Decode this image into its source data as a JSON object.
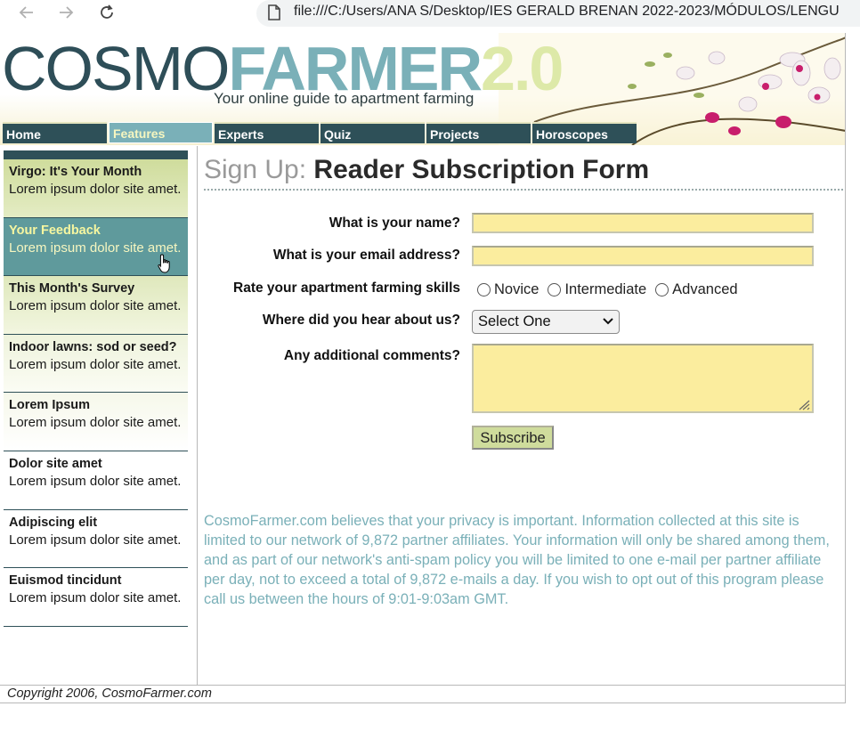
{
  "browser": {
    "url": "file:///C:/Users/ANA S/Desktop/IES GERALD BRENAN 2022-2023/MÓDULOS/LENGU"
  },
  "header": {
    "logo_part1": "COSMO",
    "logo_part2": "FARMER",
    "logo_part3": "2.0",
    "tagline": "Your online guide to apartment farming"
  },
  "nav": {
    "items": [
      {
        "label": "Home"
      },
      {
        "label": "Features"
      },
      {
        "label": "Experts"
      },
      {
        "label": "Quiz"
      },
      {
        "label": "Projects"
      },
      {
        "label": "Horoscopes"
      }
    ],
    "active": "Features"
  },
  "sidebar": {
    "items": [
      {
        "title": "Virgo: It's Your Month",
        "desc": "Lorem ipsum dolor site amet."
      },
      {
        "title": "Your Feedback",
        "desc": "Lorem ipsum dolor site amet."
      },
      {
        "title": "This Month's Survey",
        "desc": "Lorem ipsum dolor site amet."
      },
      {
        "title": "Indoor lawns: sod or seed?",
        "desc": "Lorem ipsum dolor site amet."
      },
      {
        "title": "Lorem Ipsum",
        "desc": "Lorem ipsum dolor site amet."
      },
      {
        "title": "Dolor site amet",
        "desc": "Lorem ipsum dolor site amet."
      },
      {
        "title": "Adipiscing elit",
        "desc": "Lorem ipsum dolor site amet."
      },
      {
        "title": "Euismod tincidunt",
        "desc": "Lorem ipsum dolor site amet."
      }
    ]
  },
  "main": {
    "heading_light": "Sign Up:",
    "heading_bold": "Reader Subscription Form",
    "form": {
      "name_label": "What is your name?",
      "name_value": "",
      "email_label": "What is your email address?",
      "email_value": "",
      "skills_label": "Rate your apartment farming skills",
      "skills_options": [
        "Novice",
        "Intermediate",
        "Advanced"
      ],
      "hear_label": "Where did you hear about us?",
      "hear_selected": "Select One",
      "comments_label": "Any additional comments?",
      "comments_value": "",
      "submit_label": "Subscribe"
    },
    "privacy": "CosmoFarmer.com believes that your privacy is important. Information collected at this site is limited to our network of 9,872 partner affiliates. Your information will only be shared among them, and as part of our network's anti-spam policy you will be limited to one e-mail per partner affiliate per day, not to exceed a total of 9,872 e-mails a day. If you wish to opt out of this program please call us between the hours of 9:01-9:03am GMT."
  },
  "footer": {
    "copyright": "Copyright 2006, CosmoFarmer.com"
  },
  "colors": {
    "dark_teal": "#2e5058",
    "light_teal": "#7ab0b8",
    "field_yellow": "#fbed9e",
    "green_button": "#cfdc9c"
  }
}
